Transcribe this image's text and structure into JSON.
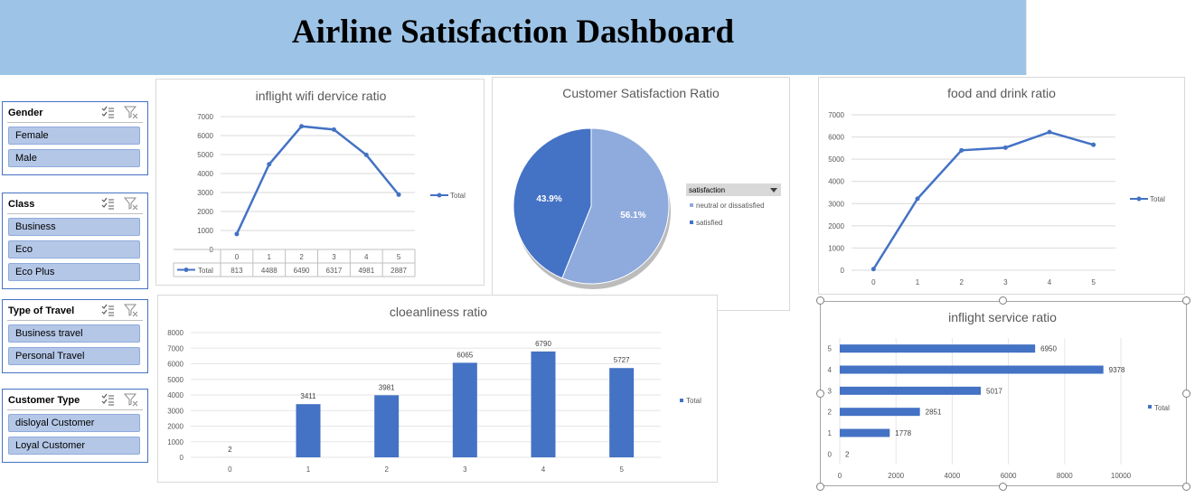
{
  "title": "Airline Satisfaction Dashboard",
  "slicers": [
    {
      "header": "Gender",
      "items": [
        "Female",
        "Male"
      ]
    },
    {
      "header": "Class",
      "items": [
        "Business",
        "Eco",
        "Eco Plus"
      ]
    },
    {
      "header": "Type of Travel",
      "items": [
        "Business travel",
        "Personal Travel"
      ]
    },
    {
      "header": "Customer Type",
      "items": [
        "disloyal Customer",
        "Loyal Customer"
      ]
    }
  ],
  "legend_total": "Total",
  "chart_data": [
    {
      "type": "line",
      "title": "inflight wifi dervice ratio",
      "categories": [
        "0",
        "1",
        "2",
        "3",
        "4",
        "5"
      ],
      "series": [
        {
          "name": "Total",
          "values": [
            813,
            4488,
            6490,
            6317,
            4981,
            2887
          ]
        }
      ],
      "ylim": [
        0,
        7000
      ],
      "yticks": [
        "0",
        "1000",
        "2000",
        "3000",
        "4000",
        "5000",
        "6000",
        "7000"
      ],
      "data_table": true,
      "color": "#4472c4",
      "legend": "right"
    },
    {
      "type": "pie",
      "title": "Customer Satisfaction Ratio",
      "legend_title": "satisfaction",
      "labels": [
        "neutral or dissatisfied",
        "satisfied"
      ],
      "values": [
        56.1,
        43.9
      ],
      "value_labels": [
        "56.1%",
        "43.9%"
      ],
      "colors": [
        "#8faadc",
        "#4472c4"
      ],
      "legend": "right"
    },
    {
      "type": "line",
      "title": "food and drink ratio",
      "categories": [
        "0",
        "1",
        "2",
        "3",
        "4",
        "5"
      ],
      "series": [
        {
          "name": "Total",
          "values": [
            50,
            3220,
            5400,
            5520,
            6220,
            5650
          ]
        }
      ],
      "ylim": [
        0,
        7000
      ],
      "yticks": [
        "0",
        "1000",
        "2000",
        "3000",
        "4000",
        "5000",
        "6000",
        "7000"
      ],
      "color": "#4472c4",
      "legend": "right"
    },
    {
      "type": "bar",
      "title": "cloeanliness ratio",
      "categories": [
        "0",
        "1",
        "2",
        "3",
        "4",
        "5"
      ],
      "series": [
        {
          "name": "Total",
          "values": [
            2,
            3411,
            3981,
            6065,
            6790,
            5727
          ]
        }
      ],
      "ylim": [
        0,
        8000
      ],
      "yticks": [
        "0",
        "1000",
        "2000",
        "3000",
        "4000",
        "5000",
        "6000",
        "7000",
        "8000"
      ],
      "color": "#4472c4",
      "legend": "right"
    },
    {
      "type": "bar",
      "orientation": "horizontal",
      "title": "inflight service ratio",
      "categories": [
        "0",
        "1",
        "2",
        "3",
        "4",
        "5"
      ],
      "series": [
        {
          "name": "Total",
          "values": [
            2,
            1778,
            2851,
            5017,
            9378,
            6950
          ]
        }
      ],
      "xlim": [
        0,
        10000
      ],
      "xticks": [
        "0",
        "2000",
        "4000",
        "6000",
        "8000",
        "10000"
      ],
      "color": "#4472c4",
      "legend": "right"
    }
  ]
}
